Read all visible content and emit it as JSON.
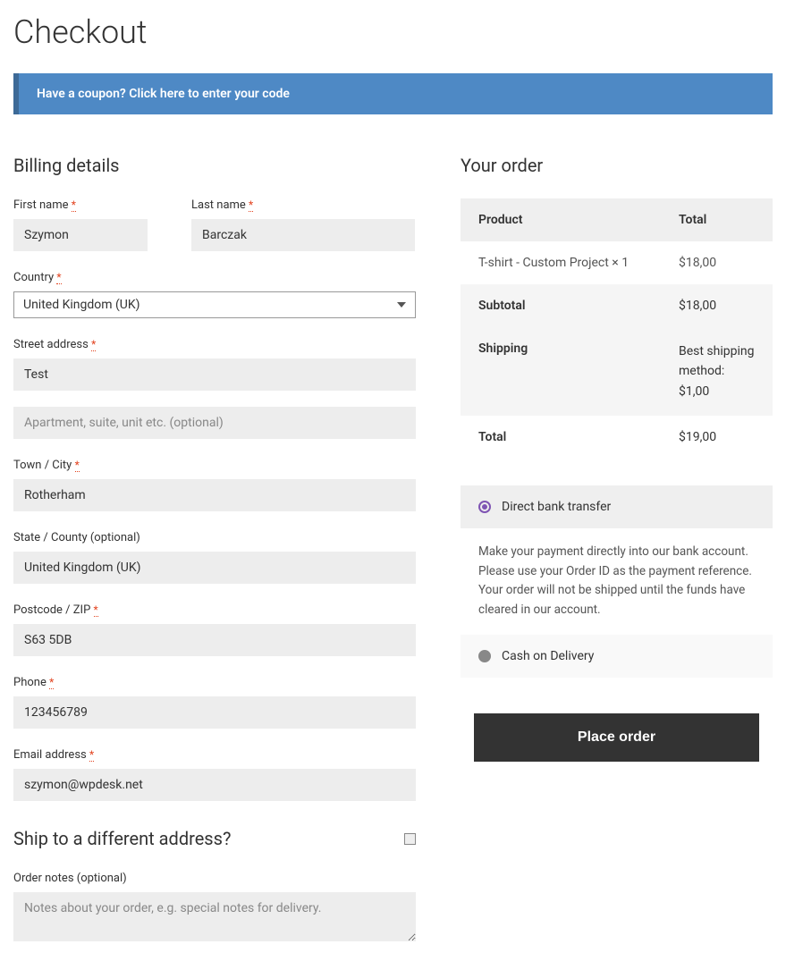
{
  "page_title": "Checkout",
  "coupon": {
    "question": "Have a coupon?",
    "link": "Click here to enter your code"
  },
  "billing": {
    "heading": "Billing details",
    "first_name": {
      "label": "First name",
      "value": "Szymon"
    },
    "last_name": {
      "label": "Last name",
      "value": "Barczak"
    },
    "country": {
      "label": "Country",
      "value": "United Kingdom (UK)"
    },
    "street": {
      "label": "Street address",
      "value": "Test",
      "placeholder2": "Apartment, suite, unit etc. (optional)"
    },
    "city": {
      "label": "Town / City",
      "value": "Rotherham"
    },
    "state": {
      "label": "State / County (optional)",
      "value": "United Kingdom (UK)"
    },
    "postcode": {
      "label": "Postcode / ZIP",
      "value": "S63 5DB"
    },
    "phone": {
      "label": "Phone",
      "value": "123456789"
    },
    "email": {
      "label": "Email address",
      "value": "szymon@wpdesk.net"
    }
  },
  "shipping": {
    "heading": "Ship to a different address?",
    "notes_label": "Order notes (optional)",
    "notes_placeholder": "Notes about your order, e.g. special notes for delivery."
  },
  "order": {
    "heading": "Your order",
    "col_product": "Product",
    "col_total": "Total",
    "item_name": "T-shirt - Custom Project  × 1",
    "item_total": "$18,00",
    "subtotal_label": "Subtotal",
    "subtotal_value": "$18,00",
    "shipping_label": "Shipping",
    "shipping_value": "Best shipping method: $1,00",
    "total_label": "Total",
    "total_value": "$19,00"
  },
  "payment": {
    "bank_label": "Direct bank transfer",
    "bank_desc": "Make your payment directly into our bank account. Please use your Order ID as the payment reference. Your order will not be shipped until the funds have cleared in our account.",
    "cod_label": "Cash on Delivery",
    "button": "Place order"
  }
}
